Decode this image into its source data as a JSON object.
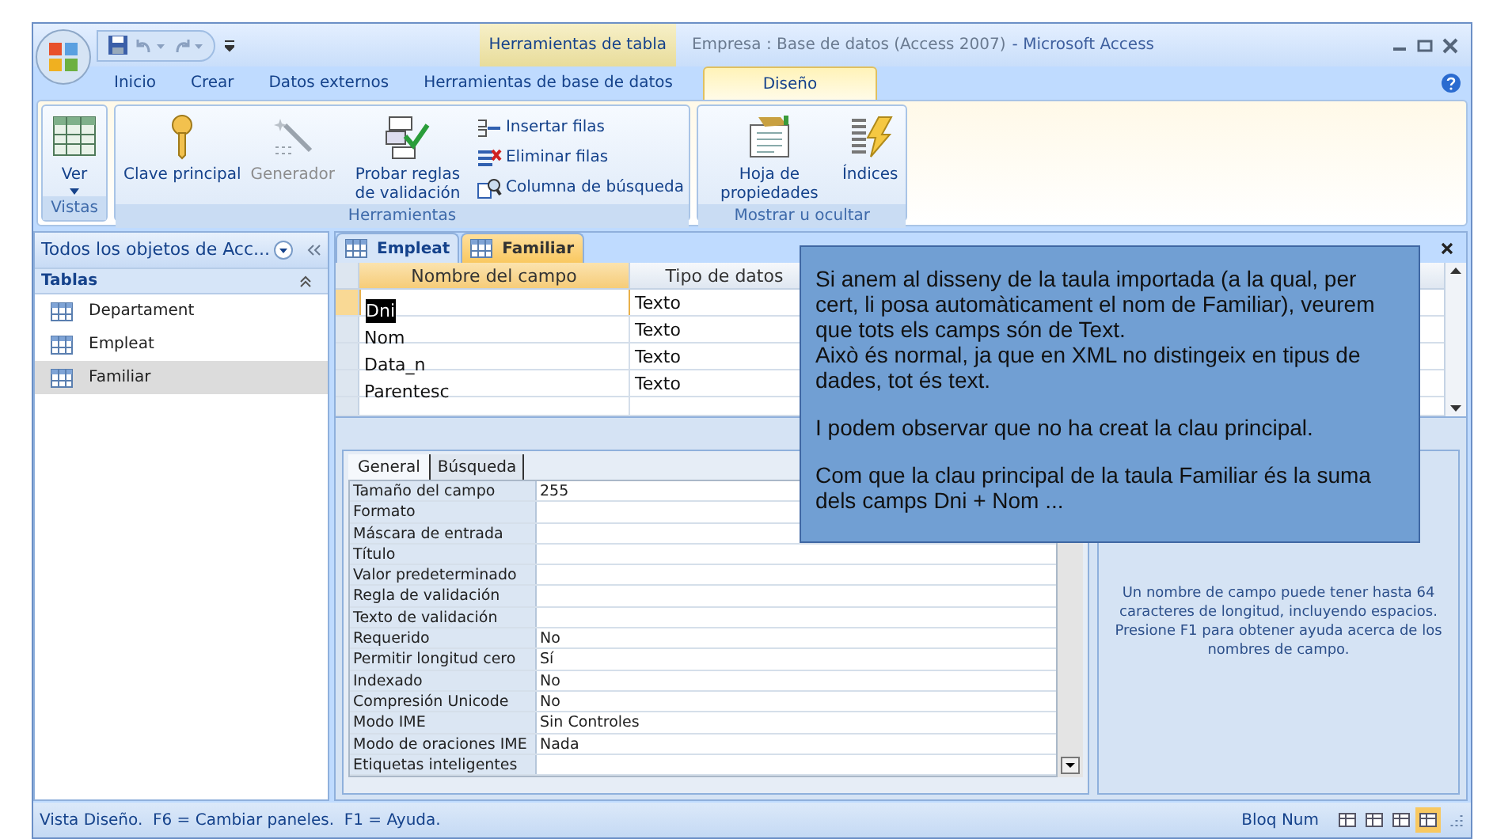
{
  "window": {
    "title": "Empresa : Base de datos (Access 2007)",
    "app": "- Microsoft Access"
  },
  "contextual_tab": "Herramientas de tabla",
  "ribbon_tabs": [
    {
      "label": "Inicio",
      "selected": false
    },
    {
      "label": "Crear",
      "selected": false
    },
    {
      "label": "Datos externos",
      "selected": false
    },
    {
      "label": "Herramientas de base de datos",
      "selected": false
    },
    {
      "label": "Diseño",
      "selected": true
    }
  ],
  "ribbon_groups": [
    {
      "label": "Vistas",
      "buttons": [
        {
          "kind": "large",
          "label": "Ver",
          "dropdown": true,
          "disabled": false
        }
      ]
    },
    {
      "label": "Herramientas",
      "buttons": [
        {
          "kind": "large",
          "label": "Clave principal",
          "dropdown": false,
          "disabled": false
        },
        {
          "kind": "large",
          "label": "Generador",
          "dropdown": false,
          "disabled": true
        },
        {
          "kind": "large",
          "label": "Probar reglas de validación",
          "dropdown": false,
          "disabled": false
        },
        {
          "kind": "small",
          "label": "Insertar filas",
          "disabled": false
        },
        {
          "kind": "small",
          "label": "Eliminar filas",
          "disabled": false
        },
        {
          "kind": "small",
          "label": "Columna de búsqueda",
          "disabled": false
        }
      ]
    },
    {
      "label": "Mostrar u ocultar",
      "buttons": [
        {
          "kind": "large",
          "label": "Hoja de propiedades",
          "dropdown": false,
          "disabled": false
        },
        {
          "kind": "large",
          "label": "Índices",
          "dropdown": false,
          "disabled": false
        }
      ]
    }
  ],
  "nav_pane": {
    "title": "Todos los objetos de Acc...",
    "section": "Tablas",
    "items": [
      {
        "label": "Departament",
        "selected": false
      },
      {
        "label": "Empleat",
        "selected": false
      },
      {
        "label": "Familiar",
        "selected": true
      }
    ]
  },
  "doc_tabs": [
    {
      "label": "Empleat",
      "selected": false
    },
    {
      "label": "Familiar",
      "selected": true
    }
  ],
  "design_grid": {
    "columns": [
      "Nombre del campo",
      "Tipo de datos"
    ],
    "rows": [
      {
        "name": "Dni",
        "type": "Texto",
        "selected": true
      },
      {
        "name": "Nom",
        "type": "Texto",
        "selected": false
      },
      {
        "name": "Data_n",
        "type": "Texto",
        "selected": false
      },
      {
        "name": "Parentesc",
        "type": "Texto",
        "selected": false
      }
    ]
  },
  "property_tabs": [
    {
      "label": "General",
      "selected": true
    },
    {
      "label": "Búsqueda",
      "selected": false
    }
  ],
  "properties": [
    {
      "label": "Tamaño del campo",
      "value": "255"
    },
    {
      "label": "Formato"
    },
    {
      "label": "Máscara de entrada"
    },
    {
      "label": "Título"
    },
    {
      "label": "Valor predeterminado"
    },
    {
      "label": "Regla de validación"
    },
    {
      "label": "Texto de validación"
    },
    {
      "label": "Requerido",
      "value": "No"
    },
    {
      "label": "Permitir longitud cero",
      "value": "Sí"
    },
    {
      "label": "Indexado",
      "value": "No"
    },
    {
      "label": "Compresión Unicode",
      "value": "No"
    },
    {
      "label": "Modo IME",
      "value": "Sin Controles"
    },
    {
      "label": "Modo de oraciones IME",
      "value": "Nada"
    },
    {
      "label": "Etiquetas inteligentes"
    }
  ],
  "help_text": "Un nombre de campo puede tener hasta 64 caracteres de longitud, incluyendo espacios. Presione F1 para obtener ayuda acerca de los nombres de campo.",
  "callout": {
    "blocks": [
      {
        "lines": [
          "Si anem al disseny de la taula importada (a la qual, per cert, li posa automàticament el nom de Familiar), veurem que tots els camps són de Text.",
          "Això és normal, ja que en XML no distingeix en tipus de dades, tot és text."
        ]
      },
      {
        "lines": [
          "I podem observar que no ha creat la clau principal."
        ]
      },
      {
        "lines": [
          "Com que la clau principal de la taula Familiar és la suma dels camps Dni + Nom ..."
        ]
      }
    ]
  },
  "status_bar": {
    "left": "Vista Diseño.  F6 = Cambiar paneles.  F1 = Ayuda.",
    "right": "Bloq Num"
  }
}
